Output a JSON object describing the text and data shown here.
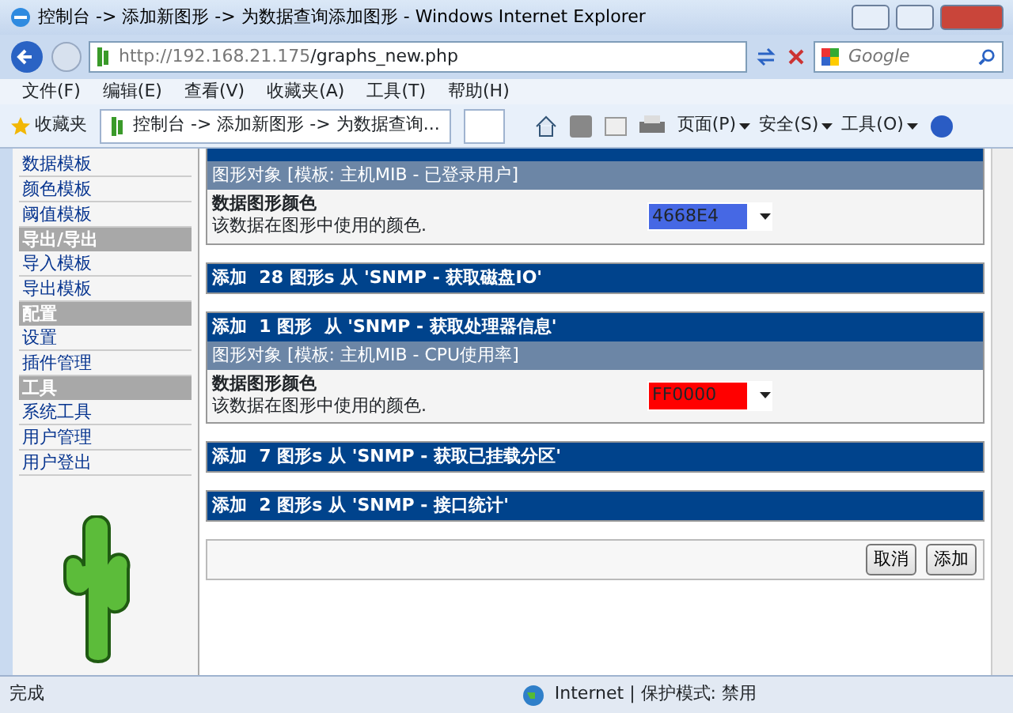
{
  "window": {
    "title": "控制台 -> 添加新图形 -> 为数据查询添加图形 - Windows Internet Explorer"
  },
  "address": {
    "url_host": "http://192.168.21.175",
    "url_path": "/graphs_new.php"
  },
  "search": {
    "placeholder": "Google"
  },
  "menu": [
    "文件(F)",
    "编辑(E)",
    "查看(V)",
    "收藏夹(A)",
    "工具(T)",
    "帮助(H)"
  ],
  "favorites": {
    "label": "收藏夹"
  },
  "tab": {
    "title": "控制台 -> 添加新图形 -> 为数据查询..."
  },
  "toolbar": [
    "页面(P)",
    "安全(S)",
    "工具(O)"
  ],
  "sidebar": [
    {
      "kind": "link",
      "label": "数据模板"
    },
    {
      "kind": "link",
      "label": "颜色模板"
    },
    {
      "kind": "link",
      "label": "阈值模板"
    },
    {
      "kind": "header",
      "label": "导出/导出"
    },
    {
      "kind": "link",
      "label": "导入模板"
    },
    {
      "kind": "link",
      "label": "导出模板"
    },
    {
      "kind": "header",
      "label": "配置"
    },
    {
      "kind": "link",
      "label": "设置"
    },
    {
      "kind": "link",
      "label": "插件管理"
    },
    {
      "kind": "header",
      "label": "工具"
    },
    {
      "kind": "link",
      "label": "系统工具"
    },
    {
      "kind": "link",
      "label": "用户管理"
    },
    {
      "kind": "link",
      "label": "用户登出"
    }
  ],
  "sections": [
    {
      "object": "图形对象 [模板: 主机MIB - 已登录用户]",
      "field_label": "数据图形颜色",
      "field_desc": "该数据在图形中使用的颜色.",
      "value": "4668E4",
      "color": "#4668e4"
    },
    {
      "heading": "添加  28 图形s 从 'SNMP - 获取磁盘IO'"
    },
    {
      "heading": "添加  1 图形  从 'SNMP - 获取处理器信息'",
      "object": "图形对象 [模板: 主机MIB - CPU使用率]",
      "field_label": "数据图形颜色",
      "field_desc": "该数据在图形中使用的颜色.",
      "value": "FF0000",
      "color": "#ff0000"
    },
    {
      "heading": "添加  7 图形s 从 'SNMP - 获取已挂载分区'"
    },
    {
      "heading": "添加  2 图形s 从 'SNMP - 接口统计'"
    }
  ],
  "buttons": [
    "取消",
    "添加"
  ],
  "status_bar": {
    "text": "完成",
    "zone": "Internet | 保护模式: 禁用"
  }
}
